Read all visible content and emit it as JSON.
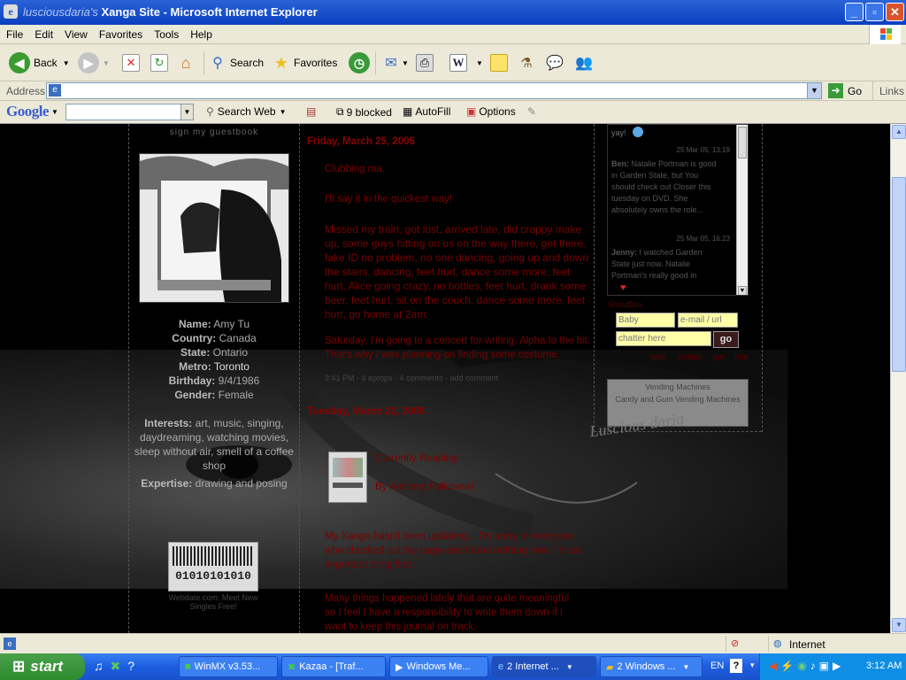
{
  "window": {
    "title": "Xanga Site - Microsoft Internet Explorer",
    "title_prefix": "lusciousdaria's",
    "buttons": {
      "min": "_",
      "max": "▫",
      "close": "✕"
    }
  },
  "menu": [
    "File",
    "Edit",
    "View",
    "Favorites",
    "Tools",
    "Help"
  ],
  "toolbar": {
    "back": "Back",
    "search": "Search",
    "favorites": "Favorites"
  },
  "address": {
    "label": "Address",
    "value": "",
    "go": "Go",
    "links": "Links"
  },
  "google": {
    "logo": "Google",
    "search_web": "Search Web",
    "blocked": "9 blocked",
    "autofill": "AutoFill",
    "options": "Options"
  },
  "profile": {
    "guestbook": "sign my guestbook",
    "name_label": "Name:",
    "name": "Amy Tu",
    "country_label": "Country:",
    "country": "Canada",
    "state_label": "State:",
    "state": "Ontario",
    "metro_label": "Metro:",
    "metro": "Toronto",
    "birthday_label": "Birthday:",
    "birthday": "9/4/1986",
    "gender_label": "Gender:",
    "gender": "Female",
    "interests_label": "Interests:",
    "interests": "art, music, singing, daydreaming, watching movies, sleep without air, smell of a coffee shop",
    "expertise_label": "Expertise:",
    "expertise": "drawing and posing",
    "badge": "01010101010",
    "webdate": "Webdate.com: Meet New Singles Free!"
  },
  "blog": {
    "entry1_date": "Friday, March 25, 2005",
    "entry1_title": "Clubbing ma.",
    "entry1_intro": "I'll say it in the quickest way!",
    "entry1_body": "Missed my train, got lost, arrived late, did crappy make up, some guys hitting on us on the way there, got there, fake ID no problem, no one dancing, going up and down the stairs, dancing, feet hurt, dance some more, feet hurt, Alice going crazy, no bottles, feet hurt, drank some beer, feet hurt, sit on the couch, dance some more, feet hurt, go home at 2am.",
    "entry1_tail": "Saturday, I'm going to a concert for writing. Alpha to the hit. That's why I was planning on finding some costume.",
    "entry1_footer": "3:41 PM - 4 eprops - 4 comments - add comment",
    "entry2_date": "Tuesday, March 22, 2005",
    "entry2_line1": "Currently Reading",
    "entry2_line2": "By Anthony Falkowski",
    "entry2_body": "My Xanga hasn't been updating... I'm sorry to everyone who checked out my page and found nothing new. I'm an important thing first.",
    "entry2_tail": "Many things happened lately that are quite meaningful so I feel I have a responsibility to write them down if I want to keep this journal on track."
  },
  "chat": {
    "yay": "yay!",
    "t1": "25 Mar 05, 13:19",
    "m1_name": "Ben:",
    "m1": "Natalie Portman is good in Garden State, but You should check out Closer this tuesday on DVD. She absolutely owns the role...",
    "t2": "25 Mar 05, 16:23",
    "m2_name": "Jenny:",
    "m2": "I watched Garden State just now. Natalie Portman's really good in",
    "name_ph": "Baby",
    "email_ph": "e-mail / url",
    "chatter_ph": "chatter here",
    "go": "go",
    "links": [
      "help",
      "smilies",
      "get one"
    ],
    "free_label": "ShoutBox",
    "ad_title": "Vending Machines",
    "ad_body": "Candy and Gum Vending Machines"
  },
  "status": {
    "zone": "Internet"
  },
  "taskbar": {
    "start": "start",
    "tasks": [
      "WinMX v3.53...",
      "Kazaa - [Traf...",
      "Windows Me...",
      "2 Internet ...",
      "2 Windows ..."
    ],
    "lang": "EN",
    "clock": "3:12 AM"
  },
  "signature": "Luscious daria"
}
